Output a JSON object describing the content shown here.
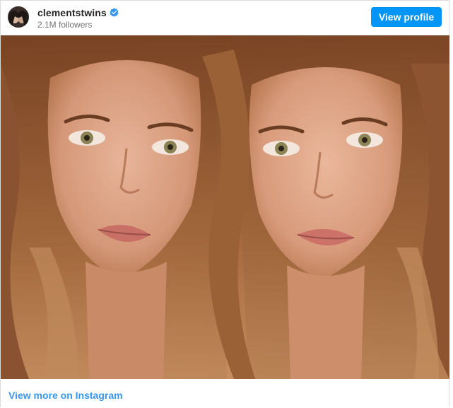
{
  "header": {
    "username": "clementstwins",
    "followers": "2.1M followers",
    "view_profile_label": "View profile"
  },
  "footer": {
    "view_more_label": "View more on Instagram"
  },
  "icons": {
    "avatar": "profile-avatar",
    "verified": "verified-badge-icon"
  },
  "colors": {
    "accent": "#0095f6",
    "link": "#3897f0",
    "verified": "#3897f0"
  }
}
